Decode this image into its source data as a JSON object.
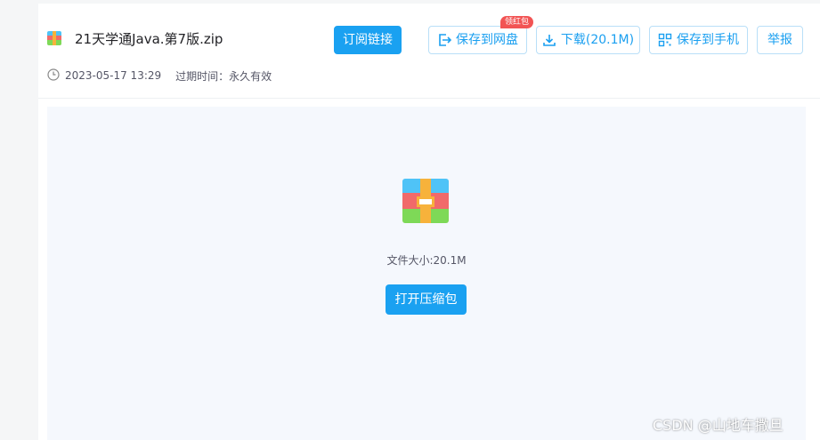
{
  "file": {
    "name": "21天学通Java.第7版.zip",
    "icon": "zip-archive-icon",
    "date": "2023-05-17 13:29",
    "expire_label": "过期时间：永久有效"
  },
  "toolbar": {
    "subscribe_label": "订阅链接",
    "save_cloud_label": "保存到网盘",
    "save_cloud_badge": "领红包",
    "download_label": "下载(20.1M)",
    "save_phone_label": "保存到手机",
    "report_label": "举报"
  },
  "preview": {
    "size_text": "文件大小:20.1M",
    "open_label": "打开压缩包"
  },
  "watermark": "CSDN @山地车撒旦",
  "colors": {
    "accent": "#1aa1f1",
    "badge": "#f25454",
    "preview_bg": "#f5f8fd"
  }
}
